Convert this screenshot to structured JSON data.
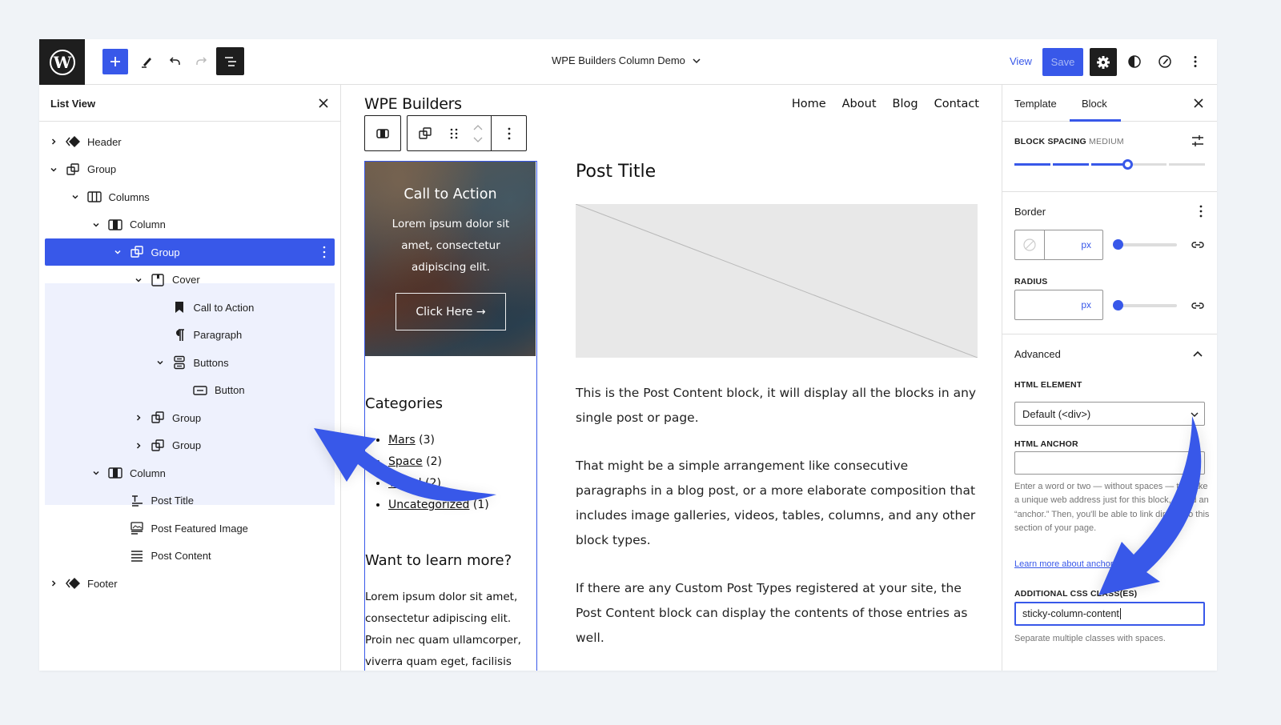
{
  "topbar": {
    "logo": "wordpress-logo",
    "add_block": "plus-icon",
    "tools": "pencil-icon",
    "undo": "undo-icon",
    "redo": "redo-icon",
    "list_view": "list-view-icon",
    "document_title": "WPE Builders Column Demo",
    "view_label": "View",
    "save_label": "Save",
    "settings": "gear-icon",
    "styles": "half-circle-icon",
    "tools_right": "compass-icon",
    "more": "ellipsis-vertical-icon"
  },
  "list_view": {
    "title": "List View",
    "close": "close-icon",
    "items": [
      {
        "label": "Header",
        "icon": "template-part-icon",
        "level": 0,
        "chevron": "right"
      },
      {
        "label": "Group",
        "icon": "group-icon",
        "level": 0,
        "chevron": "down"
      },
      {
        "label": "Columns",
        "icon": "columns-icon",
        "level": 1,
        "chevron": "down"
      },
      {
        "label": "Column",
        "icon": "column-icon",
        "level": 2,
        "chevron": "down"
      },
      {
        "label": "Group",
        "icon": "group-icon",
        "level": 3,
        "chevron": "down",
        "selected": true
      },
      {
        "label": "Cover",
        "icon": "cover-icon",
        "level": 4,
        "chevron": "down"
      },
      {
        "label": "Call to Action",
        "icon": "bookmark-icon",
        "level": 5,
        "chevron": ""
      },
      {
        "label": "Paragraph",
        "icon": "paragraph-icon",
        "level": 5,
        "chevron": ""
      },
      {
        "label": "Buttons",
        "icon": "buttons-icon",
        "level": 5,
        "chevron": "down"
      },
      {
        "label": "Button",
        "icon": "button-icon",
        "level": 6,
        "chevron": ""
      },
      {
        "label": "Group",
        "icon": "group-icon",
        "level": 4,
        "chevron": "right"
      },
      {
        "label": "Group",
        "icon": "group-icon",
        "level": 4,
        "chevron": "right"
      },
      {
        "label": "Column",
        "icon": "column-icon",
        "level": 2,
        "chevron": "down"
      },
      {
        "label": "Post Title",
        "icon": "post-title-icon",
        "level": 3,
        "chevron": ""
      },
      {
        "label": "Post Featured Image",
        "icon": "featured-image-icon",
        "level": 3,
        "chevron": ""
      },
      {
        "label": "Post Content",
        "icon": "post-content-icon",
        "level": 3,
        "chevron": ""
      },
      {
        "label": "Footer",
        "icon": "template-part-icon",
        "level": 0,
        "chevron": "right"
      }
    ]
  },
  "canvas": {
    "site_title": "WPE Builders",
    "nav": [
      "Home",
      "About",
      "Blog",
      "Contact"
    ],
    "block_toolbar": [
      "column-icon",
      "group-icon",
      "drag-handle-icon",
      "move-up-down-icon",
      "more-options-icon"
    ],
    "cover": {
      "title": "Call to Action",
      "text": "Lorem ipsum dolor sit amet, consectetur adipiscing elit.",
      "button": "Click Here →"
    },
    "categories": {
      "title": "Categories",
      "items": [
        {
          "name": "Mars",
          "count": "(3)"
        },
        {
          "name": "Space",
          "count": "(2)"
        },
        {
          "name": "Travel",
          "count": "(2)"
        },
        {
          "name": "Uncategorized",
          "count": "(1)"
        }
      ]
    },
    "learn_more": {
      "title": "Want to learn more?",
      "text": "Lorem ipsum dolor sit amet, consectetur adipiscing elit. Proin nec quam ullamcorper, viverra quam eget, facilisis"
    },
    "post_title": "Post Title",
    "post_content": [
      "This is the Post Content block, it will display all the blocks in any single post or page.",
      "That might be a simple arrangement like consecutive paragraphs in a blog post, or a more elaborate composition that includes image galleries, videos, tables, columns, and any other block types.",
      "If there are any Custom Post Types registered at your site, the Post Content block can display the contents of those entries as well."
    ]
  },
  "settings": {
    "tabs": [
      "Template",
      "Block"
    ],
    "active_tab": "Block",
    "close": "close-icon",
    "block_spacing": {
      "label": "BLOCK SPACING",
      "value_label": "MEDIUM",
      "step": 3,
      "steps_total": 5,
      "options_icon": "sliders-icon"
    },
    "border": {
      "title": "Border",
      "width_value": "",
      "unit": "px",
      "slider_value": 0,
      "link_icon": "link-icon",
      "color_icon": "no-color-icon",
      "more_icon": "ellipsis-vertical-icon"
    },
    "radius": {
      "label": "RADIUS",
      "value": "",
      "unit": "px",
      "slider_value": 0,
      "link_icon": "link-icon"
    },
    "advanced": {
      "title": "Advanced",
      "html_element_label": "HTML ELEMENT",
      "html_element_value": "Default (<div>)",
      "html_anchor_label": "HTML ANCHOR",
      "html_anchor_value": "",
      "anchor_help": "Enter a word or two — without spaces — to make a unique web address just for this block, called an “anchor.” Then, you'll be able to link directly to this section of your page.",
      "anchor_link": "Learn more about anchors",
      "css_label": "ADDITIONAL CSS CLASS(ES)",
      "css_value": "sticky-column-content",
      "css_help": "Separate multiple classes with spaces."
    }
  },
  "colors": {
    "accent": "#3858e9",
    "dark": "#1e1e1e",
    "selection_bg": "#eef1fd",
    "border": "#e0e0e0"
  }
}
